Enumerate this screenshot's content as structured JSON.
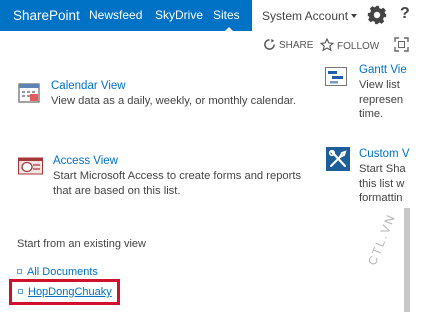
{
  "suite_bar": {
    "brand": "SharePoint",
    "nav": [
      "Newsfeed",
      "SkyDrive",
      "Sites"
    ],
    "account": "System Account",
    "help": "?",
    "brand_color": "#0072c6"
  },
  "actions": {
    "share": "SHARE",
    "follow": "FOLLOW"
  },
  "tiles": {
    "calendar": {
      "title": "Calendar View",
      "description": "View data as a daily, weekly, or monthly calendar.",
      "icon": "calendar-icon"
    },
    "access": {
      "title": "Access View",
      "description": "Start Microsoft Access to create forms and reports that are based on this list.",
      "icon": "access-icon"
    },
    "gantt": {
      "title": "Gantt Vie",
      "description": "View list\nrepresen\ntime.",
      "icon": "gantt-chart-icon"
    },
    "custom": {
      "title": "Custom V",
      "description": "Start Sha\nthis list w\nformattin",
      "icon": "custom-tools-icon"
    }
  },
  "existing_views": {
    "label": "Start from an existing view",
    "items": [
      "All Documents",
      "HopDongChuaky"
    ],
    "highlight_color": "#d0112b"
  },
  "watermark": "CTL.VN"
}
